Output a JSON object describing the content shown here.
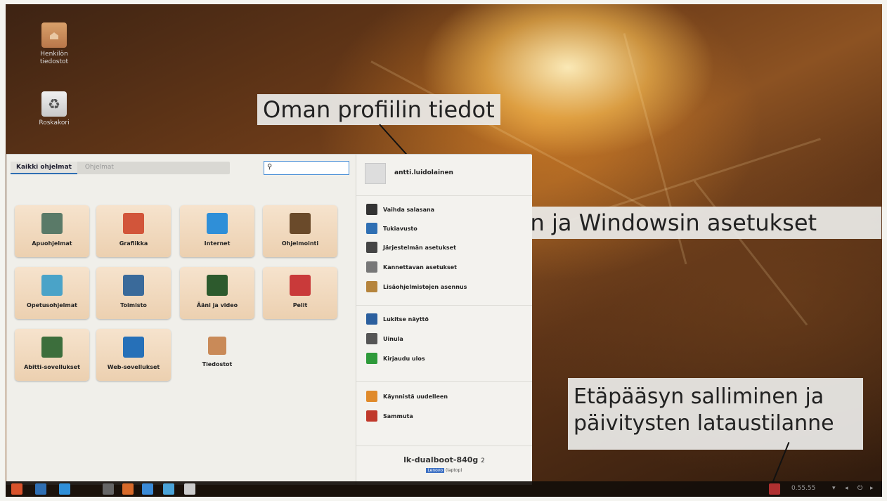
{
  "callouts": {
    "profile": "Oman profiilin tiedot",
    "settings": "Abitin ja Windowsin asetukset",
    "remote_line1": "Etäpääsyn salliminen ja",
    "remote_line2": "päivitysten lataustilanne"
  },
  "desktop": {
    "icons": [
      {
        "name": "folder-icon",
        "label_line1": "Henkilön",
        "label_line2": "tiedostot"
      },
      {
        "name": "trash-icon",
        "label_line1": "Roskakori",
        "label_line2": ""
      }
    ]
  },
  "menu": {
    "tabs": [
      "Kaikki ohjelmat",
      "Ohjelmat"
    ],
    "search": {
      "placeholder": "",
      "icon": "search-icon"
    },
    "tiles": [
      {
        "label": "Apuohjelmat",
        "icon": "tools-icon",
        "color": "#5a7a68"
      },
      {
        "label": "Grafiikka",
        "icon": "paint-icon",
        "color": "#d2553a"
      },
      {
        "label": "Internet",
        "icon": "globe-icon",
        "color": "#2f8fd8"
      },
      {
        "label": "Ohjelmointi",
        "icon": "code-icon",
        "color": "#6a4a2a"
      },
      {
        "label": "Opetusohjelmat",
        "icon": "education-icon",
        "color": "#4aa3c8"
      },
      {
        "label": "Toimisto",
        "icon": "office-icon",
        "color": "#3a6a9a"
      },
      {
        "label": "Ääni ja video",
        "icon": "media-icon",
        "color": "#2d5a2d"
      },
      {
        "label": "Pelit",
        "icon": "cards-icon",
        "color": "#c93a3a"
      },
      {
        "label": "Abitti-sovellukset",
        "icon": "blackboard-icon",
        "color": "#3c6e3c"
      },
      {
        "label": "Web-sovellukset",
        "icon": "globe-blue-icon",
        "color": "#2670b8"
      },
      {
        "label": "Tiedostot",
        "icon": "home-folder-icon",
        "color": "#c98a58"
      }
    ],
    "user": {
      "name": "antti.luidolainen"
    },
    "actions": [
      {
        "label": "Vaihda salasana",
        "icon": "lock-icon",
        "color": "#333333"
      },
      {
        "label": "Tukiavusto",
        "icon": "help-icon",
        "color": "#2f6fb3"
      },
      {
        "label": "Järjestelmän asetukset",
        "icon": "system-settings-icon",
        "color": "#444444"
      },
      {
        "label": "Kannettavan asetukset",
        "icon": "laptop-settings-icon",
        "color": "#777777"
      },
      {
        "label": "Lisäohjelmistojen asennus",
        "icon": "package-icon",
        "color": "#b5843c"
      },
      {
        "label": "Lukitse näyttö",
        "icon": "lock-screen-icon",
        "color": "#2b5f9e"
      },
      {
        "label": "Uinula",
        "icon": "sleep-icon",
        "color": "#555555"
      },
      {
        "label": "Kirjaudu ulos",
        "icon": "logout-icon",
        "color": "#2e9a3a"
      },
      {
        "label": "Käynnistä uudelleen",
        "icon": "restart-icon",
        "color": "#e08a2a"
      },
      {
        "label": "Sammuta",
        "icon": "power-icon",
        "color": "#c0392b"
      }
    ],
    "hostname": "lk-dualboot-840g",
    "hostname_suffix": "2",
    "host_sub_badge": "Lenovo",
    "host_sub": "(laptop)"
  },
  "taskbar": {
    "apps": [
      {
        "icon": "menu-icon",
        "color": "#d9532c"
      },
      {
        "icon": "window-icon",
        "color": "#2f6fb3"
      },
      {
        "icon": "browser-icon",
        "color": "#2f8fd8"
      },
      {
        "icon": "terminal-icon",
        "color": "#666666"
      },
      {
        "icon": "firefox-icon",
        "color": "#d86a2a"
      },
      {
        "icon": "chromium-icon",
        "color": "#3a8ad6"
      },
      {
        "icon": "chat-icon",
        "color": "#4aa3d8"
      },
      {
        "icon": "files-icon",
        "color": "#cccccc"
      }
    ],
    "clock": "0.55.55",
    "tray_icons": [
      "network-icon",
      "volume-icon",
      "power-tray-icon"
    ]
  }
}
